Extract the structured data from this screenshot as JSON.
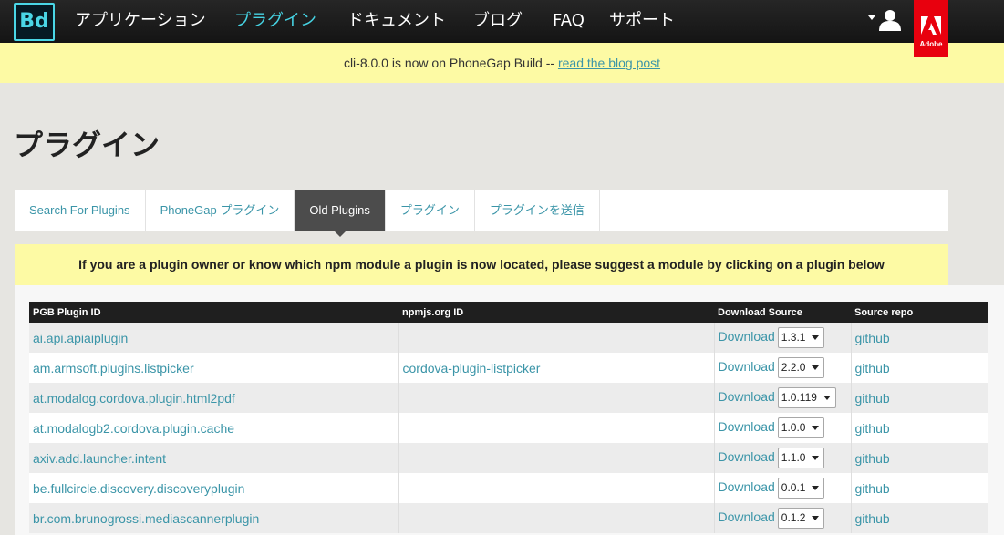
{
  "nav": {
    "logo": "Bd",
    "items": [
      {
        "label": "アプリケーション",
        "active": false
      },
      {
        "label": "プラグイン",
        "active": true
      },
      {
        "label": "ドキュメント",
        "active": false
      },
      {
        "label": "ブログ",
        "active": false
      },
      {
        "label": "FAQ",
        "active": false
      },
      {
        "label": "サポート",
        "active": false
      }
    ],
    "adobe_label": "Adobe"
  },
  "banner": {
    "text": "cli-8.0.0 is now on PhoneGap Build -- ",
    "link": "read the blog post"
  },
  "page": {
    "title": "プラグイン"
  },
  "tabs": [
    {
      "label": "Search For Plugins",
      "active": false
    },
    {
      "label": "PhoneGap プラグイン",
      "active": false
    },
    {
      "label": "Old Plugins",
      "active": true
    },
    {
      "label": "プラグイン",
      "active": false
    },
    {
      "label": "プラグインを送信",
      "active": false
    }
  ],
  "notice": "If you are a plugin owner or know which npm module a plugin is now located, please suggest a module by clicking on a plugin below",
  "table": {
    "headers": [
      "PGB Plugin ID",
      "npmjs.org ID",
      "Download Source",
      "Source repo"
    ],
    "download_label": "Download",
    "repo_label": "github",
    "rows": [
      {
        "id": "ai.api.apiaiplugin",
        "npm": "",
        "version": "1.3.1"
      },
      {
        "id": "am.armsoft.plugins.listpicker",
        "npm": "cordova-plugin-listpicker",
        "version": "2.2.0"
      },
      {
        "id": "at.modalog.cordova.plugin.html2pdf",
        "npm": "",
        "version": "1.0.119"
      },
      {
        "id": "at.modalogb2.cordova.plugin.cache",
        "npm": "",
        "version": "1.0.0"
      },
      {
        "id": "axiv.add.launcher.intent",
        "npm": "",
        "version": "1.1.0"
      },
      {
        "id": "be.fullcircle.discovery.discoveryplugin",
        "npm": "",
        "version": "0.0.1"
      },
      {
        "id": "br.com.brunogrossi.mediascannerplugin",
        "npm": "",
        "version": "0.1.2"
      }
    ]
  },
  "colors": {
    "accent": "#46d3e3",
    "link": "#3b95a8",
    "banner_bg": "#fdfaa4",
    "nav_bg": "#1a1a1a",
    "adobe_red": "#e8000e"
  }
}
